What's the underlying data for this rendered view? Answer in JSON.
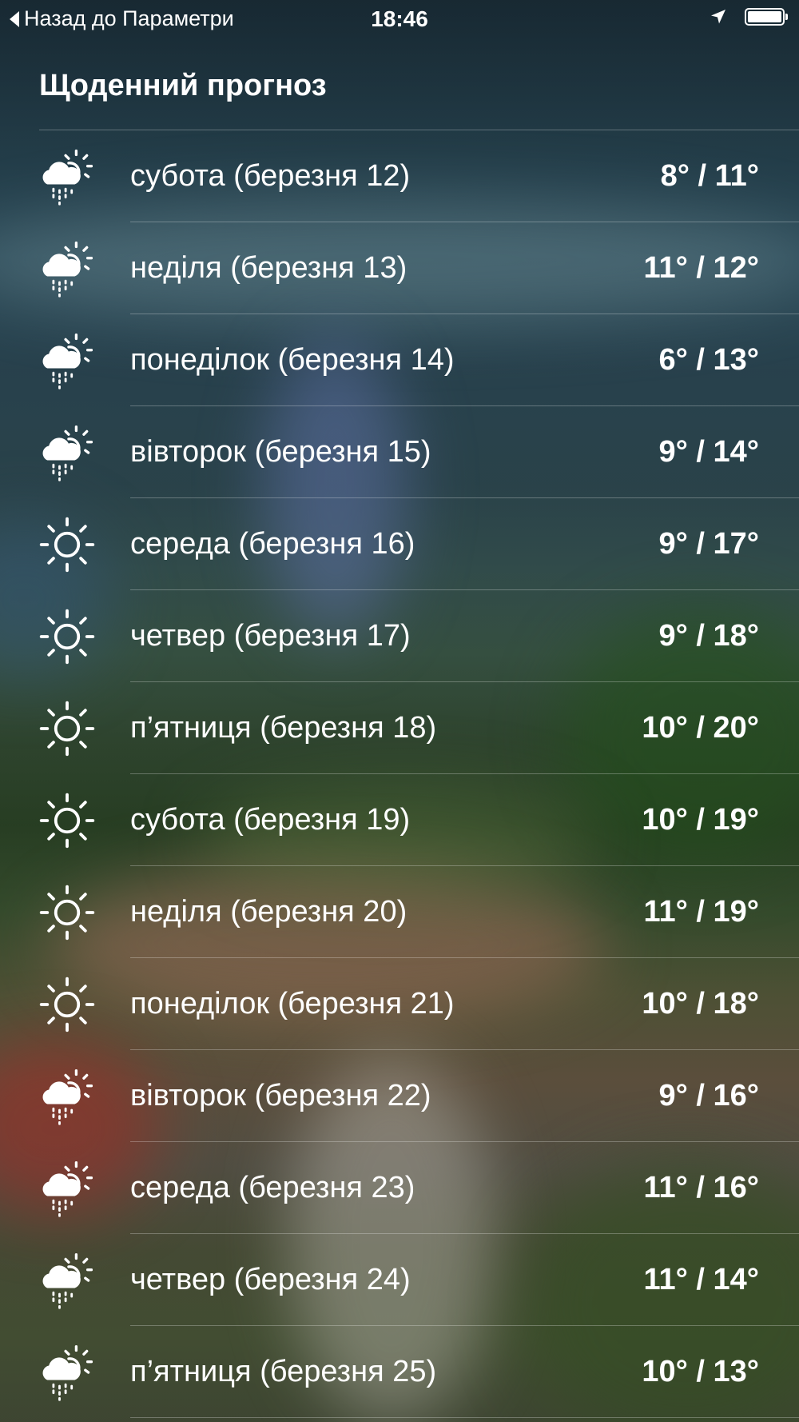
{
  "status_bar": {
    "back_label": "Назад до Параметри",
    "time": "18:46",
    "location_icon": "location-arrow-icon",
    "battery_icon": "battery-icon",
    "battery_level": 1.0
  },
  "title": "Щоденний прогноз",
  "days": [
    {
      "label": "субота (березня 12)",
      "temp": "8° / 11°",
      "icon": "partly-sunny-rain-icon"
    },
    {
      "label": "неділя (березня 13)",
      "temp": "11° / 12°",
      "icon": "partly-sunny-rain-icon"
    },
    {
      "label": "понеділок (березня 14)",
      "temp": "6° / 13°",
      "icon": "partly-sunny-rain-icon"
    },
    {
      "label": "вівторок (березня 15)",
      "temp": "9° / 14°",
      "icon": "partly-sunny-rain-icon"
    },
    {
      "label": "середа (березня 16)",
      "temp": "9° / 17°",
      "icon": "sun-icon"
    },
    {
      "label": "четвер (березня 17)",
      "temp": "9° / 18°",
      "icon": "sun-icon"
    },
    {
      "label": "п’ятниця (березня 18)",
      "temp": "10° / 20°",
      "icon": "sun-icon"
    },
    {
      "label": "субота (березня 19)",
      "temp": "10° / 19°",
      "icon": "sun-icon"
    },
    {
      "label": "неділя (березня 20)",
      "temp": "11° / 19°",
      "icon": "sun-icon"
    },
    {
      "label": "понеділок (березня 21)",
      "temp": "10° / 18°",
      "icon": "sun-icon"
    },
    {
      "label": "вівторок (березня 22)",
      "temp": "9° / 16°",
      "icon": "partly-sunny-rain-icon"
    },
    {
      "label": "середа (березня 23)",
      "temp": "11° / 16°",
      "icon": "partly-sunny-rain-icon"
    },
    {
      "label": "четвер (березня 24)",
      "temp": "11° / 14°",
      "icon": "partly-sunny-rain-icon"
    },
    {
      "label": "п’ятниця (березня 25)",
      "temp": "10° / 13°",
      "icon": "partly-sunny-rain-icon"
    }
  ]
}
